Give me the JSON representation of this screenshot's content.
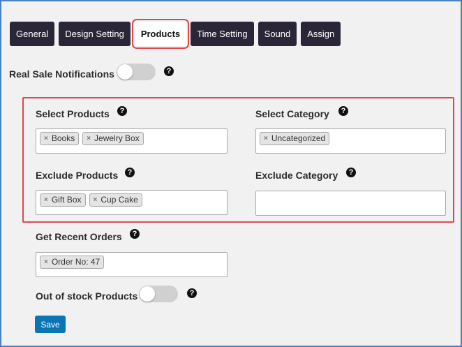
{
  "tabs": [
    {
      "label": "General"
    },
    {
      "label": "Design Setting"
    },
    {
      "label": "Products",
      "active": true
    },
    {
      "label": "Time Setting"
    },
    {
      "label": "Sound"
    },
    {
      "label": "Assign"
    }
  ],
  "real_sale": {
    "label": "Real Sale Notifications",
    "enabled": false
  },
  "select_products": {
    "label": "Select Products",
    "chips": [
      "Books",
      "Jewelry Box"
    ]
  },
  "select_category": {
    "label": "Select Category",
    "chips": [
      "Uncategorized"
    ]
  },
  "exclude_products": {
    "label": "Exclude Products",
    "chips": [
      "Gift Box",
      "Cup Cake"
    ]
  },
  "exclude_category": {
    "label": "Exclude Category",
    "chips": []
  },
  "recent_orders": {
    "label": "Get Recent Orders",
    "chips": [
      "Order No: 47"
    ]
  },
  "out_of_stock": {
    "label": "Out of stock Products",
    "enabled": false
  },
  "save_label": "Save",
  "help_glyph": "?",
  "chip_remove_glyph": "×",
  "colors": {
    "tab_bg": "#2a2638",
    "highlight": "#e0474d",
    "save_bg": "#0a74b5"
  }
}
